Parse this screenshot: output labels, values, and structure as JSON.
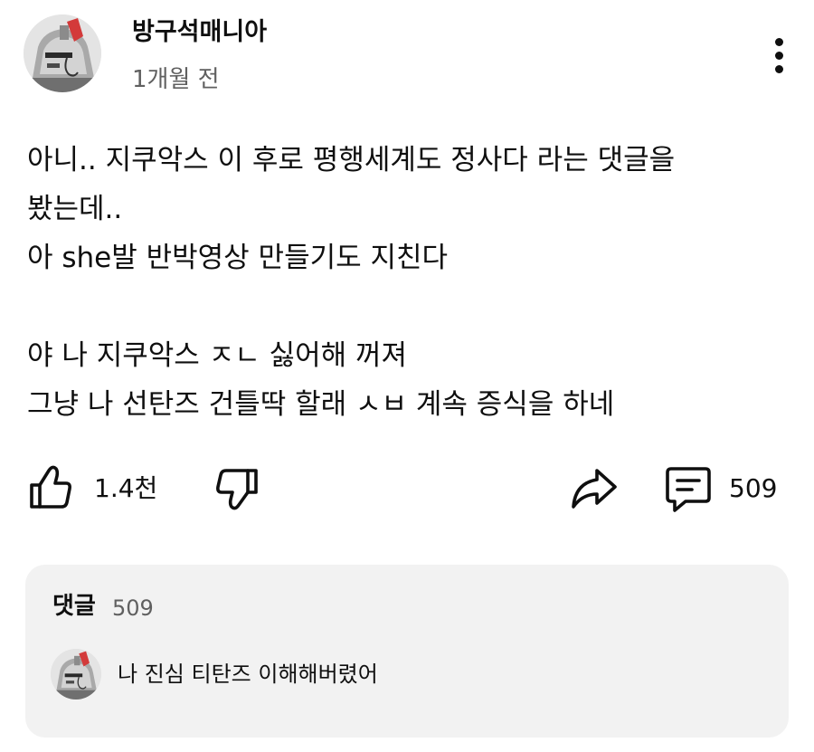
{
  "post": {
    "channel_name": "방구석매니아",
    "time_ago": "1개월 전",
    "avatar_icon": "robot-mech-head-icon",
    "menu_icon": "more-vert-icon",
    "body_lines": [
      "아니.. 지쿠악스 이 후로 평행세계도 정사다 라는 댓글을",
      "봤는데..",
      "아 she발 반박영상 만들기도 지친다",
      "",
      "야 나 지쿠악스 ㅈㄴ 싫어해 꺼져",
      "그냥 나 선탄즈 건틀딱 할래 ㅅㅂ 계속 증식을 하네"
    ]
  },
  "actions": {
    "like_icon": "thumbs-up-icon",
    "like_count": "1.4천",
    "dislike_icon": "thumbs-down-icon",
    "share_icon": "share-arrow-icon",
    "comment_icon": "comment-bubble-icon",
    "comment_count": "509"
  },
  "comments": {
    "title": "댓글",
    "count": "509",
    "top_comment_text": "나 진심 티탄즈 이해해버렸어",
    "top_comment_avatar_icon": "robot-mech-head-icon"
  },
  "colors": {
    "text_primary": "#0f0f0f",
    "text_secondary": "#606060",
    "panel_background": "#f2f2f2",
    "background": "#ffffff"
  }
}
